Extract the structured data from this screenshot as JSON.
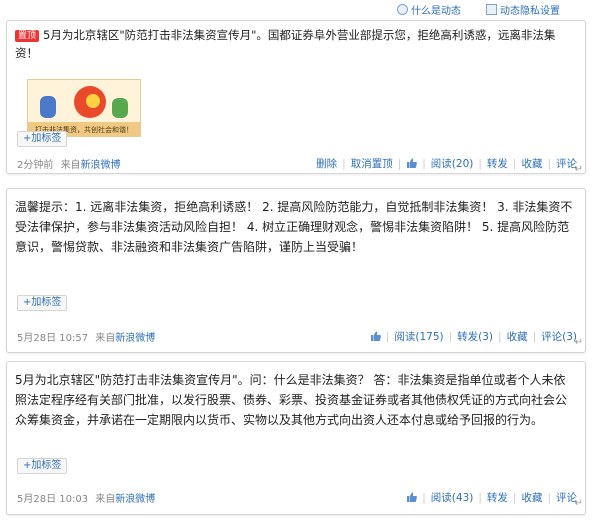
{
  "topbar": {
    "whats_new": "什么是动态",
    "privacy_settings": "动态隐私设置"
  },
  "posts": [
    {
      "pin_badge": "置顶",
      "text": "5月为北京辖区\"防范打击非法集资宣传月\"。国都证券阜外营业部提示您，拒绝高利诱惑，远离非法集资！",
      "image_caption": "打击非法集资，共创社会和谐！",
      "tag_button": "+加标签",
      "time": "2分钟前",
      "source_prefix": "来自",
      "source": "新浪微博",
      "actions": [
        "删除",
        "取消置顶",
        "阅读(20)",
        "转发",
        "收藏",
        "评论"
      ]
    },
    {
      "text": "温馨提示：1. 远离非法集资，拒绝高利诱惑！ 2. 提高风险防范能力，自觉抵制非法集资！ 3. 非法集资不受法律保护，参与非法集资活动风险自担！ 4. 树立正确理财观念，警惕非法集资陷阱！ 5. 提高风险防范意识，警惕贷款、非法融资和非法集资广告陷阱，谨防上当受骗！",
      "tag_button": "+加标签",
      "time": "5月28日 10:57",
      "source_prefix": "来自",
      "source": "新浪微博",
      "actions": [
        "阅读(175)",
        "转发(3)",
        "收藏",
        "评论(3)"
      ]
    },
    {
      "text": "5月为北京辖区\"防范打击非法集资宣传月\"。问：什么是非法集资？ 答：非法集资是指单位或者个人未依照法定程序经有关部门批准，以发行股票、债券、彩票、投资基金证券或者其他债权凭证的方式向社会公众筹集资金，并承诺在一定期限内以货币、实物以及其他方式向出资人还本付息或给予回报的行为。",
      "tag_button": "+加标签",
      "time": "5月28日 10:03",
      "source_prefix": "来自",
      "source": "新浪微博",
      "actions": [
        "阅读(43)",
        "转发",
        "收藏",
        "评论"
      ]
    }
  ],
  "icons": {
    "like": "thumbs-up-icon",
    "help": "help-circle-icon",
    "settings": "settings-icon",
    "return": "return-arrow-icon"
  },
  "colors": {
    "link": "#2d6fb8",
    "pin_badge": "#e33333",
    "border": "#d6d6d6"
  }
}
